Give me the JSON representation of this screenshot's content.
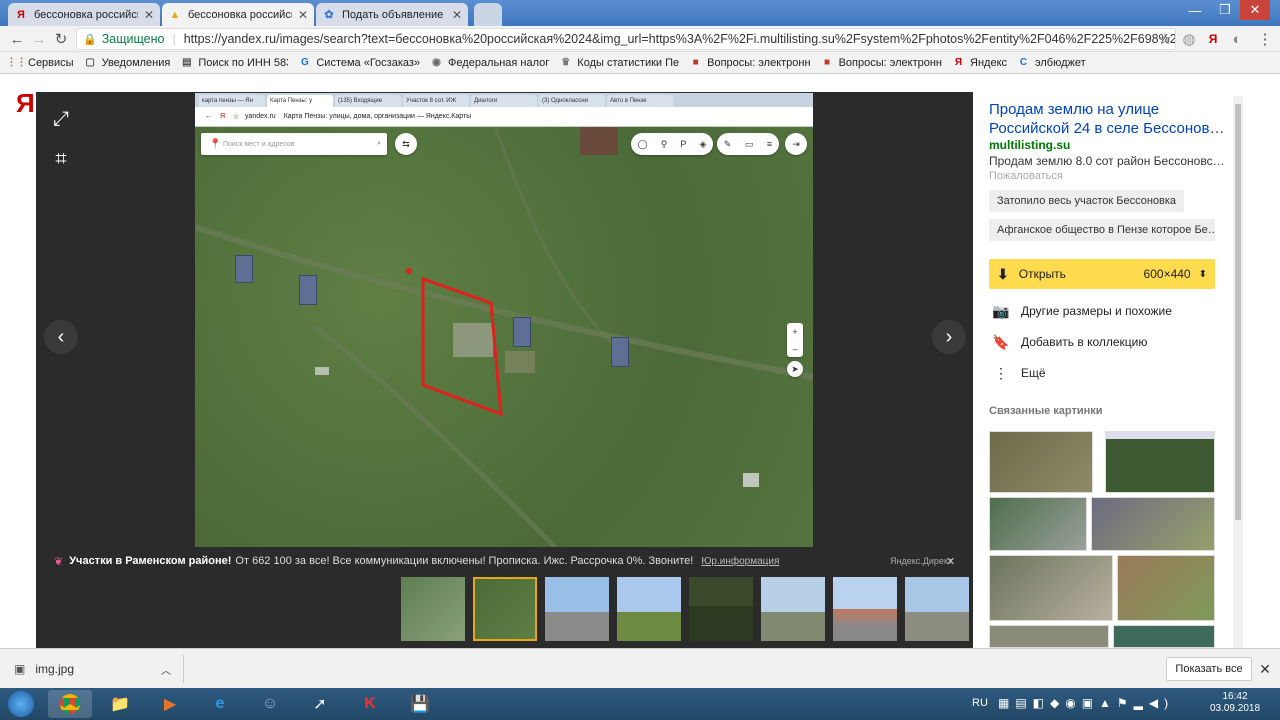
{
  "browser": {
    "tabs": [
      {
        "label": "бессоновка российская",
        "icon": "Я",
        "color": "#c00",
        "active": false
      },
      {
        "label": "бессоновка российская",
        "icon": "▲",
        "color": "#000",
        "active": true
      },
      {
        "label": "Подать объявление — С",
        "icon": "✿",
        "color": "#3a7bd5",
        "active": false
      }
    ],
    "url": {
      "secure_label": "Защищено",
      "address": "https://yandex.ru/images/search?text=бессоновка%20российская%2024&img_url=https%3A%2F%2Fi.multilisting.su%2Fsystem%2Fphotos%2Fentity%2F046%2F225%2F698%2Fmedium%2Fimg.jpe..."
    },
    "bookmarks": [
      {
        "label": "Сервисы",
        "icon": "⋮⋮",
        "color": "#d44"
      },
      {
        "label": "Уведомления",
        "icon": "▢",
        "color": "#555"
      },
      {
        "label": "Поиск по ИНН 5834",
        "icon": "▤",
        "color": "#555"
      },
      {
        "label": "Система «Госзаказ»",
        "icon": "G",
        "color": "#1a73e8"
      },
      {
        "label": "Федеральная налог",
        "icon": "◉",
        "color": "#666"
      },
      {
        "label": "Коды статистики Пе",
        "icon": "♛",
        "color": "#777"
      },
      {
        "label": "Вопросы: электронн",
        "icon": "■",
        "color": "#c0392b"
      },
      {
        "label": "Вопросы: электронн",
        "icon": "■",
        "color": "#c0392b"
      },
      {
        "label": "Яндекс",
        "icon": "Я",
        "color": "#c00"
      },
      {
        "label": "элбюджет",
        "icon": "C",
        "color": "#1a73e8"
      }
    ]
  },
  "viewer": {
    "inner_tabs": [
      "карта пензы — Ян",
      "Карта Пензы: у",
      "(135) Входящие",
      "Участок 8 сот. ИЖ",
      "Диалоги",
      "(3) Одноклассни",
      "Авто в Пензе"
    ],
    "inner_url": "yandex.ru",
    "inner_title": "Карта Пензы: улицы, дома, организации — Яндекс.Карты",
    "inner_search_placeholder": "Поиск мест и адресов",
    "ad": {
      "title": "Участки в Раменском районе!",
      "text": "От 662 100 за все! Все коммуникации включены! Прописка. Ижс. Рассрочка 0%. Звоните!",
      "legal": "Юр.информация",
      "source": "Яндекс.Директ"
    }
  },
  "panel": {
    "title": "Продам землю на улице Российской 24 в селе Бессонов…",
    "domain": "multilisting.su",
    "description": "Продам землю 8.0 сот район Бессоновск…",
    "complain": "Пожаловаться",
    "chips": [
      "Затопило весь участок Бессоновка",
      "Афганское общество в Пензе которое Бе…"
    ],
    "open_label": "Открыть",
    "size_label": "600×440",
    "actions": [
      "Другие размеры и похожие",
      "Добавить в коллекцию",
      "Ещё"
    ],
    "related_title": "Связанные картинки"
  },
  "download": {
    "filename": "img.jpg",
    "show_all": "Показать все"
  },
  "taskbar": {
    "lang": "RU",
    "time": "16:42",
    "date": "03.09.2018"
  }
}
